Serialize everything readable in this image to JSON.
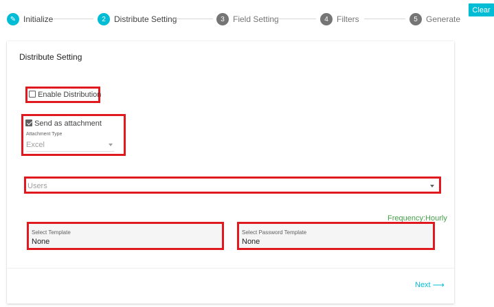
{
  "stepper": {
    "steps": [
      {
        "number": "✎",
        "label": "Initialize",
        "state": "done"
      },
      {
        "number": "2",
        "label": "Distribute Setting",
        "state": "active"
      },
      {
        "number": "3",
        "label": "Field Setting",
        "state": "todo"
      },
      {
        "number": "4",
        "label": "Filters",
        "state": "todo"
      },
      {
        "number": "5",
        "label": "Generate",
        "state": "todo"
      }
    ]
  },
  "toolbar": {
    "clear_label": "Clear"
  },
  "card": {
    "title": "Distribute Setting",
    "enable_distribution": {
      "label": "Enable Distribution",
      "checked": false
    },
    "send_as_attachment": {
      "label": "Send as attachment",
      "checked": true
    },
    "attachment_type": {
      "label": "Attachment Type",
      "value": "Excel"
    },
    "users": {
      "placeholder": "Users"
    },
    "frequency": "Frequency:Hourly",
    "select_template": {
      "label": "Select Template",
      "value": "None"
    },
    "select_password_template": {
      "label": "Select Password Template",
      "value": "None"
    },
    "next_label": "Next",
    "next_arrow": "⟶"
  },
  "colors": {
    "accent": "#00bcd4",
    "highlight_border": "#e0191e",
    "frequency": "#43a047"
  }
}
